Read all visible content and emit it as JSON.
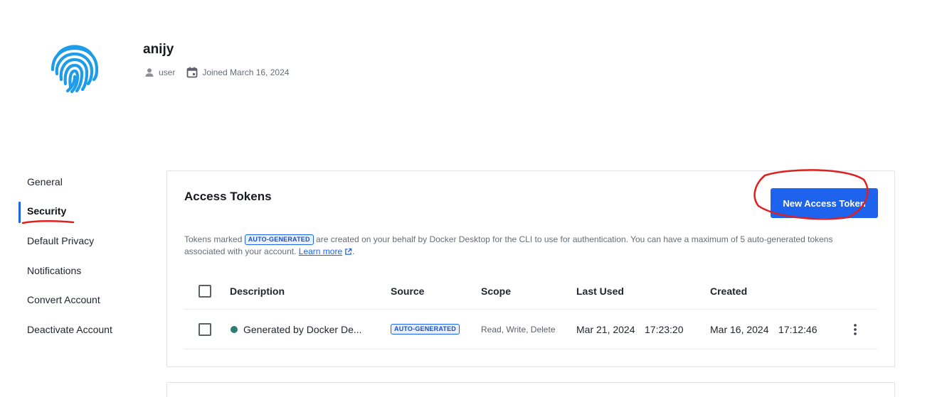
{
  "profile": {
    "username": "anijy",
    "role": "user",
    "joined": "Joined March 16, 2024"
  },
  "sidenav": {
    "items": [
      {
        "label": "General"
      },
      {
        "label": "Security",
        "active": true
      },
      {
        "label": "Default Privacy"
      },
      {
        "label": "Notifications"
      },
      {
        "label": "Convert Account"
      },
      {
        "label": "Deactivate Account"
      }
    ]
  },
  "tokens": {
    "title": "Access Tokens",
    "new_button": "New Access Token",
    "notice_part1": "Tokens marked",
    "notice_badge": "AUTO-GENERATED",
    "notice_part2": "are created on your behalf by Docker Desktop for the CLI to use for authentication. You can have a maximum of 5 auto-generated tokens associated with your account.",
    "learn_more": "Learn more",
    "notice_end": ".",
    "columns": {
      "description": "Description",
      "source": "Source",
      "scope": "Scope",
      "last_used": "Last Used",
      "created": "Created"
    },
    "rows": [
      {
        "description": "Generated by Docker De...",
        "source": "AUTO-GENERATED",
        "scope": "Read, Write, Delete",
        "last_used_date": "Mar 21, 2024",
        "last_used_time": "17:23:20",
        "created_date": "Mar 16, 2024",
        "created_time": "17:12:46"
      }
    ]
  },
  "colors": {
    "accent": "#1d63ed",
    "fingerprint": "#1e9ce8",
    "status_dot": "#2f7d72"
  }
}
